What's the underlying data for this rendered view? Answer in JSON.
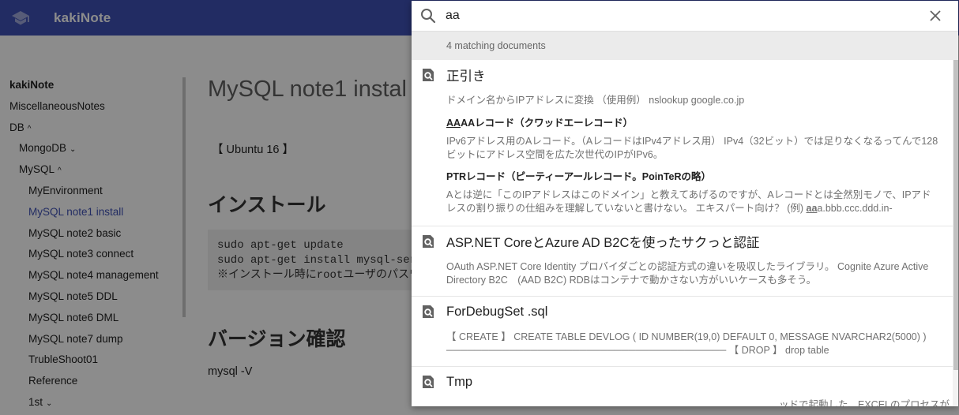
{
  "header": {
    "title": "kakiNote",
    "bg_color": "#3f51b5",
    "logo_icon": "graduation-cap-icon"
  },
  "sidebar": {
    "items": [
      {
        "label": "kakiNote",
        "level": 1,
        "bold": true
      },
      {
        "label": "MiscellaneousNotes",
        "level": 1
      },
      {
        "label": "DB",
        "level": 1,
        "caret": "^"
      },
      {
        "label": "MongoDB",
        "level": 2,
        "caret": "⌄"
      },
      {
        "label": "MySQL",
        "level": 2,
        "caret": "^"
      },
      {
        "label": "MyEnvironment",
        "level": 3
      },
      {
        "label": "MySQL note1 install",
        "level": 3,
        "active": true
      },
      {
        "label": "MySQL note2 basic",
        "level": 3
      },
      {
        "label": "MySQL note3 connect",
        "level": 3
      },
      {
        "label": "MySQL note4 management",
        "level": 3
      },
      {
        "label": "MySQL note5 DDL",
        "level": 3
      },
      {
        "label": "MySQL note6 DML",
        "level": 3
      },
      {
        "label": "MySQL note7 dump",
        "level": 3
      },
      {
        "label": "TrubleShoot01",
        "level": 3
      },
      {
        "label": "Reference",
        "level": 3
      },
      {
        "label": "1st",
        "level": 3,
        "caret": "⌄"
      }
    ]
  },
  "main": {
    "title": "MySQL note1 instal",
    "tag": "【 Ubuntu 16 】",
    "heading_install": "インストール",
    "code_lines": [
      "sudo apt-get update",
      "sudo apt-get install mysql-serv",
      "※インストール時にrootユーザのパスワ"
    ],
    "heading_version": "バージョン確認",
    "version_cmd": "mysql -V"
  },
  "search": {
    "query": "aa",
    "match_count": "4 matching documents",
    "results": [
      {
        "title": "正引き",
        "snippet": "ドメイン名からIPアドレスに変換 （使用例） nslookup google.co.jp",
        "sub_sections": [
          {
            "heading_mark": "AA",
            "heading_rest": "AAレコード（クワッドエーレコード）",
            "text": "IPv6アドレス用のAレコード。（AレコードはIPv4アドレス用） IPv4（32ビット）では足りなくなるってんで128ビットにアドレス空間を広た次世代のIPがIPv6。"
          },
          {
            "heading": "PTRレコード（ピーティーアールレコード。PoinTeRの略）",
            "text_before": "Aとは逆に「このIPアドレスはこのドメイン」と教えてあげるのですが、Aレコードとは全然別モノで、IPアドレスの割り振りの仕組みを理解していないと書けない。 エキスパート向け？ (例) ",
            "text_mark": "aa",
            "text_after": "a.bbb.ccc.ddd.in-"
          }
        ]
      },
      {
        "title": "ASP.NET CoreとAzure AD B2Cを使ったサクっと認証",
        "snippet": "OAuth ASP.NET Core Identity プロバイダごとの認証方式の違いを吸収したライブラリ。 Cognite Azure Active Directory B2C　(AAD B2C) RDBはコンテナで動かさない方がいいケースも多そう。"
      },
      {
        "title": "ForDebugSet .sql",
        "snippet_line1": "【 CREATE 】 CREATE TABLE DEVLOG ( ID NUMBER(19,0) DEFAULT 0, MESSAGE NVARCHAR2(5000) )",
        "snippet_line2": "──────────────────────────────────────── 【 DROP 】 drop table"
      },
      {
        "title": "Tmp",
        "snippet": "ッドで起動した、EXCELのプロセスが"
      }
    ]
  }
}
